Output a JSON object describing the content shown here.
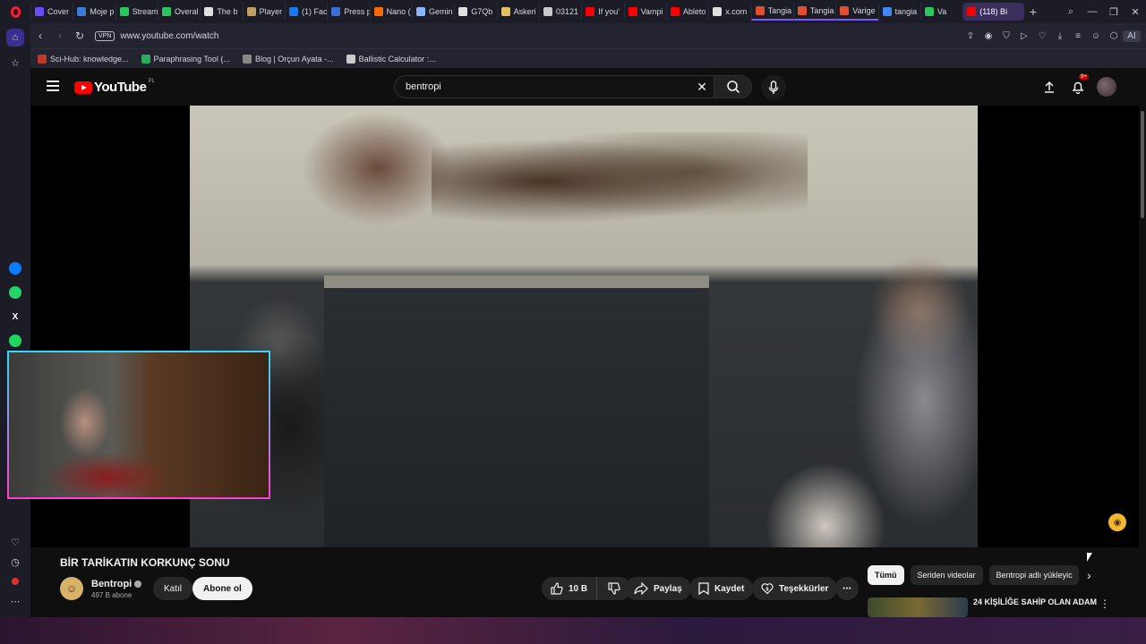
{
  "browser": {
    "tabs": [
      {
        "label": "Cover",
        "color": "#6a4cff"
      },
      {
        "label": "Moje p",
        "color": "#3a7bd5"
      },
      {
        "label": "Stream",
        "color": "#29c75f"
      },
      {
        "label": "Overal",
        "color": "#29c75f"
      },
      {
        "label": "The b",
        "color": "#e0e0e0"
      },
      {
        "label": "Player",
        "color": "#c0a060"
      },
      {
        "label": "(1) Fac",
        "color": "#1877f2"
      },
      {
        "label": "Press p",
        "color": "#3b6fd6"
      },
      {
        "label": "Nano (",
        "color": "#ff6a00"
      },
      {
        "label": "Gemin",
        "color": "#8ab4f8"
      },
      {
        "label": "G7Qb",
        "color": "#e0e0e0"
      },
      {
        "label": "Askeri",
        "color": "#e0c060"
      },
      {
        "label": "03121",
        "color": "#c8c8c8"
      },
      {
        "label": "If you'",
        "color": "#ff0000"
      },
      {
        "label": "Vampi",
        "color": "#ff0000"
      },
      {
        "label": "Ableto",
        "color": "#ff0000"
      },
      {
        "label": "x.com",
        "color": "#e0e0e0"
      },
      {
        "label": "Tangia",
        "color": "#e05030"
      },
      {
        "label": "Tangia",
        "color": "#e05030"
      },
      {
        "label": "Varige",
        "color": "#e05030"
      },
      {
        "label": "tangia",
        "color": "#4285f4"
      },
      {
        "label": "Va",
        "color": "#29c75f"
      },
      {
        "label": "(118) Bi",
        "color": "#ff0000"
      }
    ],
    "url": "www.youtube.com/watch",
    "vpn_label": "VPN",
    "ai_label": "AI",
    "bookmarks": [
      {
        "label": "Sci-Hub: knowledge...",
        "color": "#c0392b"
      },
      {
        "label": "Paraphrasing Tool (...",
        "color": "#27ae60"
      },
      {
        "label": "Blog | Orçun Ayata -...",
        "color": "#888888"
      },
      {
        "label": "Ballistic Calculator :...",
        "color": "#cccccc"
      }
    ]
  },
  "youtube": {
    "logo_text": "YouTube",
    "country_code": "PL",
    "search_value": "bentropi",
    "notifications_badge": "9+",
    "video": {
      "title": "BİR TARİKATIN KORKUNÇ SONU",
      "channel": "Bentropi",
      "subscribers": "497 B abone",
      "join_label": "Katıl",
      "subscribe_label": "Abone ol",
      "likes": "10 B",
      "share_label": "Paylaş",
      "save_label": "Kaydet",
      "thanks_label": "Teşekkürler"
    },
    "chips": [
      "Tümü",
      "Seriden videolar",
      "Bentropi adlı yükleyic"
    ],
    "recommended": [
      {
        "title": "24 KİŞİLİĞE SAHİP OLAN ADAM"
      }
    ]
  }
}
